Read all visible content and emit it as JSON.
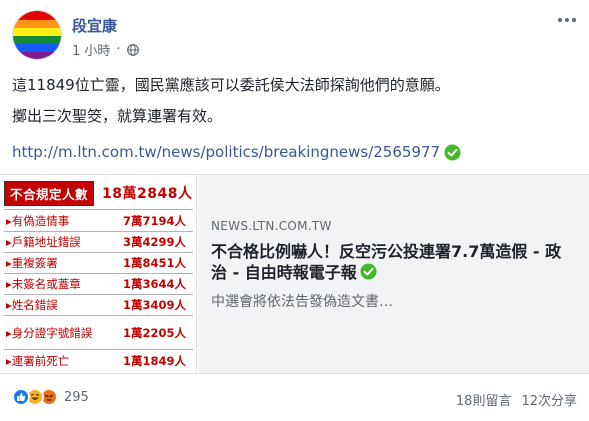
{
  "post": {
    "author": "段宜康",
    "time": "1 小時",
    "privacy_icon": "globe-icon",
    "more_icon": "ellipsis-icon",
    "text_line1": "這11849位亡靈，國民黨應該可以委託侯大法師探詢他們的意願。",
    "text_line2": "擲出三次聖筊，就算連署有效。",
    "link_url": "http://m.ltn.com.tw/news/politics/breakingnews/2565977",
    "link_icon": "check-circle-icon"
  },
  "card": {
    "domain": "NEWS.LTN.COM.TW",
    "title": "不合格比例嚇人！反空污公投連署7.7萬造假 - 政治 - 自由時報電子報",
    "description": "中選會將依法告發偽造文書…",
    "image": {
      "header_label": "不合規定人數",
      "header_total": "18萬2848人",
      "rows": [
        {
          "label": "有偽造情事",
          "value": "7萬7194人"
        },
        {
          "label": "戶籍地址錯誤",
          "value": "3萬4299人"
        },
        {
          "label": "重複簽署",
          "value": "1萬8451人"
        },
        {
          "label": "未簽名或蓋章",
          "value": "1萬3644人"
        },
        {
          "label": "姓名錯誤",
          "value": "1萬3409人"
        },
        {
          "label": "身分證字號錯誤",
          "value": "1萬2205人"
        },
        {
          "label": "連署前死亡",
          "value": "1萬1849人"
        }
      ]
    }
  },
  "footer": {
    "reaction_count": "295",
    "comments": "18則留言",
    "shares": "12次分享",
    "colors": {
      "like": "#1877f2",
      "haha": "#f7b125",
      "angry": "#e9710f"
    }
  }
}
